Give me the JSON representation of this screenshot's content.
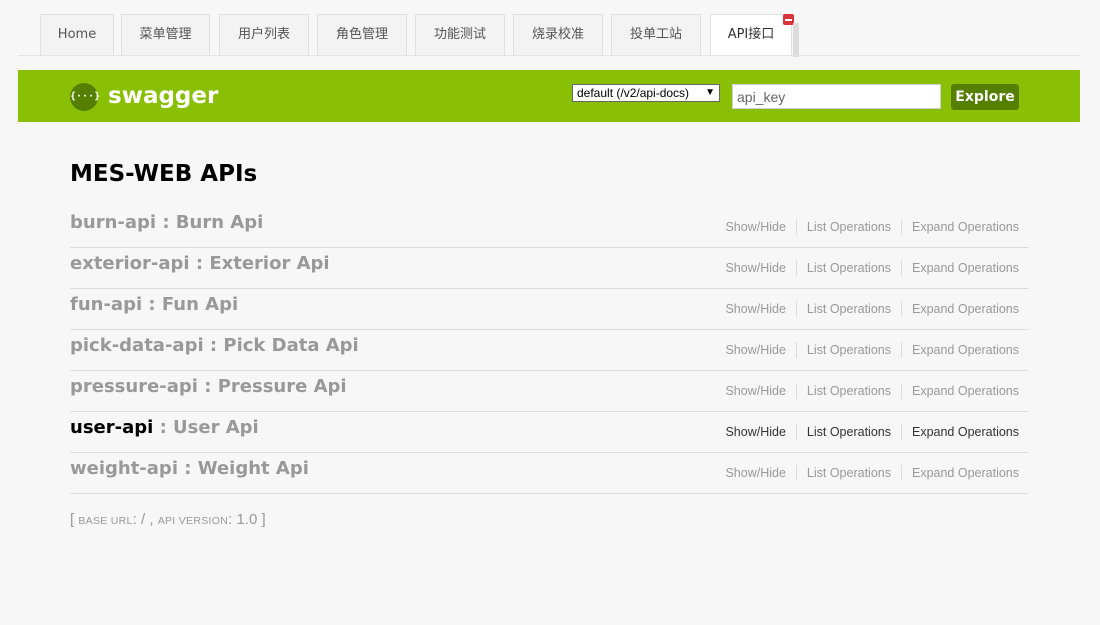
{
  "tabs": [
    {
      "label": "Home"
    },
    {
      "label": "菜单管理"
    },
    {
      "label": "用户列表"
    },
    {
      "label": "角色管理"
    },
    {
      "label": "功能测试"
    },
    {
      "label": "烧录校准"
    },
    {
      "label": "投单工站"
    },
    {
      "label": "API接口",
      "active": true
    }
  ],
  "header": {
    "logo_glyph": "{···}",
    "logo_text": "swagger",
    "spec_select_value": "default (/v2/api-docs)",
    "spec_select_caret": "▼",
    "api_key_placeholder": "api_key",
    "explore_label": "Explore",
    "brand_color": "#89bf04",
    "brand_dark": "#547f00"
  },
  "main": {
    "title": "MES-WEB APIs",
    "resources": [
      {
        "name": "burn-api",
        "description": ": Burn Api"
      },
      {
        "name": "exterior-api",
        "description": ": Exterior Api"
      },
      {
        "name": "fun-api",
        "description": ": Fun Api"
      },
      {
        "name": "pick-data-api",
        "description": ": Pick Data Api"
      },
      {
        "name": "pressure-api",
        "description": ": Pressure Api"
      },
      {
        "name": "user-api",
        "description": ": User Api",
        "highlighted": true
      },
      {
        "name": "weight-api",
        "description": ": Weight Api"
      }
    ],
    "op_labels": {
      "show_hide": "Show/Hide",
      "list_operations": "List Operations",
      "expand_operations": "Expand Operations"
    },
    "footer": {
      "open_bracket": "[",
      "base_url_label": "base url",
      "base_url_value": ": / ,",
      "api_version_label": "api version",
      "api_version_value": ": 1.0",
      "close_bracket": "]"
    }
  }
}
